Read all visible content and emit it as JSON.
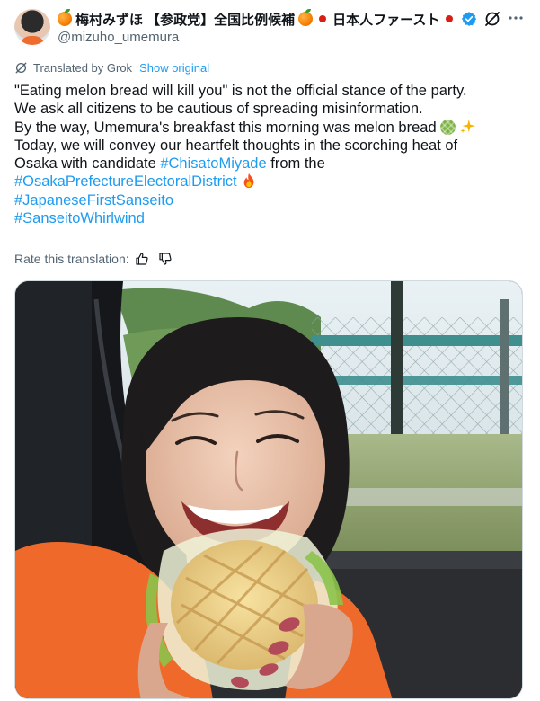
{
  "post": {
    "display_name": "梅村みずほ 【参政党】全国比例候補",
    "display_name_suffix": "日本人ファースト",
    "handle": "@mizuho_umemura"
  },
  "icons": {
    "name_emoji": "tangerine-icon",
    "separator": "red-circle-icon",
    "verified": "verified-badge-icon",
    "grok": "grok-icon",
    "more": "more-icon",
    "like_translation": "thumbs-up-icon",
    "dislike_translation": "thumbs-down-icon"
  },
  "translation": {
    "notice": "Translated by Grok",
    "show_original": "Show original",
    "rate_label": "Rate this translation:"
  },
  "body": {
    "line1": "\"Eating melon bread will kill you\" is not the official stance of the party.",
    "line2": "We ask all citizens to be cautious of spreading misinformation.",
    "line3": "By the way, Umemura's breakfast this morning was melon bread",
    "line4_pre": "Today, we will convey our heartfelt thoughts in the scorching heat of",
    "line5_pre": "Osaka with candidate ",
    "line5_tag": "#ChisatoMiyade",
    "line5_post": " from the",
    "hashtag_1": "#OsakaPrefectureElectoralDistrict",
    "hashtag_2": "#JapaneseFirstSanseito",
    "hashtag_3": "#SanseitoWhirlwind"
  },
  "colors": {
    "link": "#1d9bf0",
    "text": "#0f1419",
    "muted": "#536471",
    "verified": "#1d9bf0"
  }
}
